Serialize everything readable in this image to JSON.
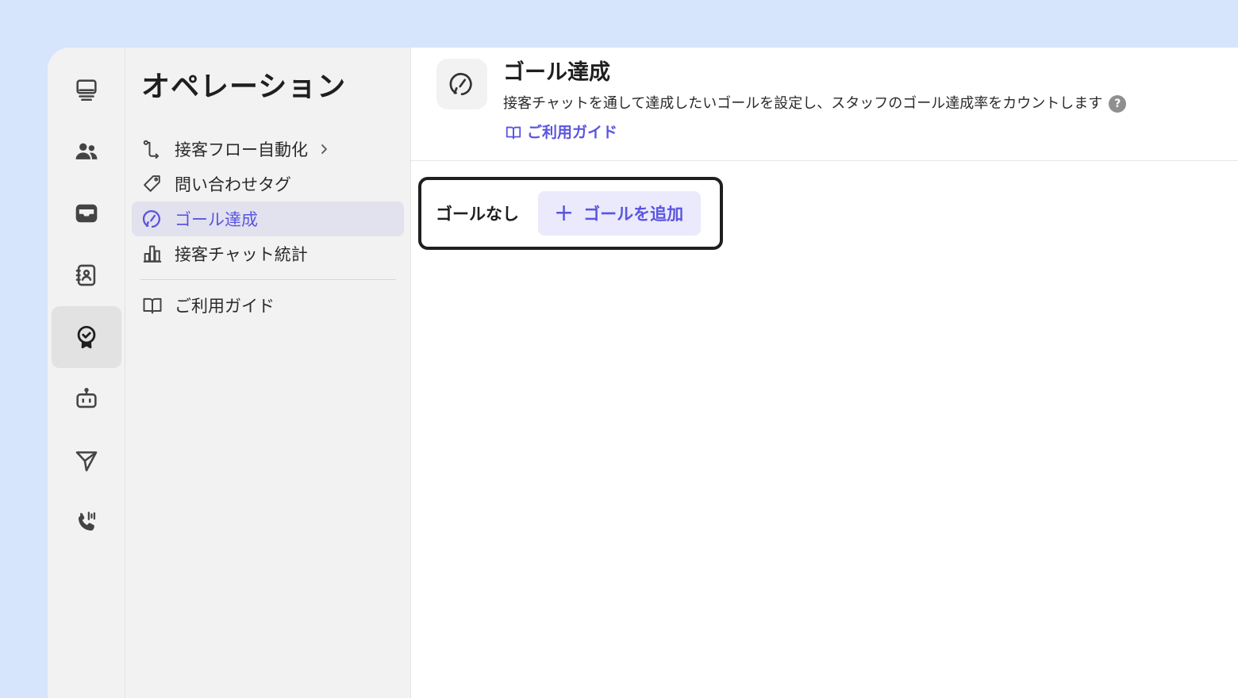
{
  "sidebar": {
    "title": "オペレーション",
    "items": [
      {
        "label": "接客フロー自動化",
        "icon": "flow-icon",
        "has_chevron": true
      },
      {
        "label": "問い合わせタグ",
        "icon": "tag-icon"
      },
      {
        "label": "ゴール達成",
        "icon": "goal-icon",
        "active": true
      },
      {
        "label": "接客チャット統計",
        "icon": "bar-chart-icon"
      }
    ],
    "footer_item": {
      "label": "ご利用ガイド",
      "icon": "book-icon"
    }
  },
  "rail": {
    "items": [
      "monitor-icon",
      "users-icon",
      "inbox-icon",
      "contact-icon",
      "badge-check-icon",
      "bot-icon",
      "send-icon",
      "phone-icon"
    ],
    "active_index": 4
  },
  "header": {
    "title": "ゴール達成",
    "description": "接客チャットを通して達成したいゴールを設定し、スタッフのゴール達成率をカウントします",
    "help_glyph": "?",
    "guide_label": "ご利用ガイド"
  },
  "goals": {
    "empty_label": "ゴールなし",
    "add_plus": "+",
    "add_label": "ゴールを追加"
  },
  "colors": {
    "accent": "#5a55e0",
    "background": "#d6e4fc",
    "sidebar": "#f2f2f2"
  }
}
